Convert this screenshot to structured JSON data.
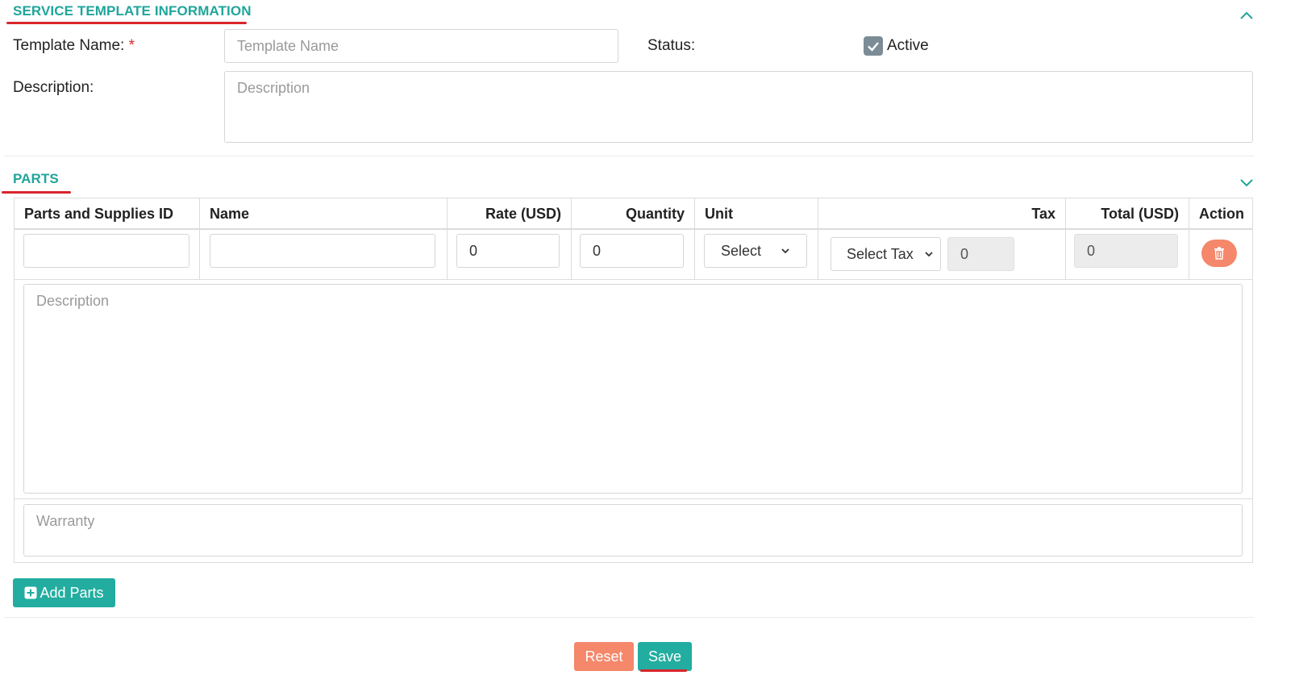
{
  "service_section": {
    "title": "SERVICE TEMPLATE INFORMATION",
    "template_name_label": "Template Name:",
    "required_mark": "*",
    "template_name_placeholder": "Template Name",
    "status_label": "Status:",
    "active_label": "Active",
    "active_checked": true,
    "description_label": "Description:",
    "description_placeholder": "Description"
  },
  "parts_section": {
    "title": "PARTS",
    "columns": [
      "Parts and Supplies ID",
      "Name",
      "Rate (USD)",
      "Quantity",
      "Unit",
      "Tax",
      "Total (USD)",
      "Action"
    ],
    "row": {
      "rate": "0",
      "quantity": "0",
      "unit": "Select",
      "tax_select": "Select Tax",
      "tax_value": "0",
      "total": "0"
    },
    "description_placeholder": "Description",
    "warranty_placeholder": "Warranty",
    "add_parts_label": "Add Parts"
  },
  "footer": {
    "reset_label": "Reset",
    "save_label": "Save"
  },
  "colors": {
    "accent": "#20a59b",
    "danger": "#f5876a",
    "highlight_underline": "#d9252b"
  }
}
